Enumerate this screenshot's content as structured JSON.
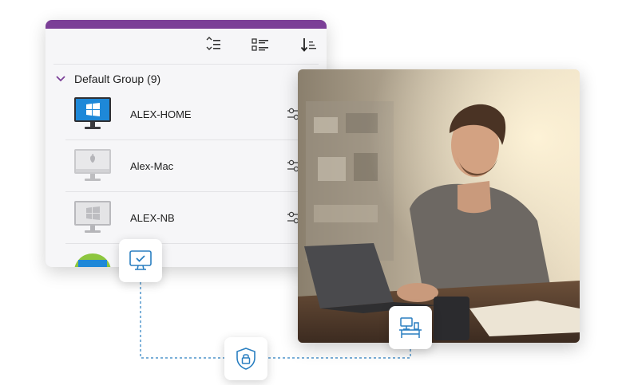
{
  "colors": {
    "accent_bar": "#7b3f97",
    "connector": "#2a7fc1",
    "windows_blue": "#1e88d8"
  },
  "toolbar": {
    "icons": [
      "sort-icon",
      "list-view-icon",
      "sort-descending-icon"
    ]
  },
  "group": {
    "title": "Default Group (9)",
    "expanded": true
  },
  "devices": [
    {
      "name": "ALEX-HOME",
      "os": "windows",
      "online": true
    },
    {
      "name": "Alex-Mac",
      "os": "mac",
      "online": false
    },
    {
      "name": "ALEX-NB",
      "os": "windows",
      "online": false
    },
    {
      "name": "",
      "os": "android",
      "online": true
    }
  ],
  "badges": [
    {
      "icon": "monitor-check-icon"
    },
    {
      "icon": "shield-lock-icon"
    },
    {
      "icon": "desk-computer-icon"
    }
  ]
}
